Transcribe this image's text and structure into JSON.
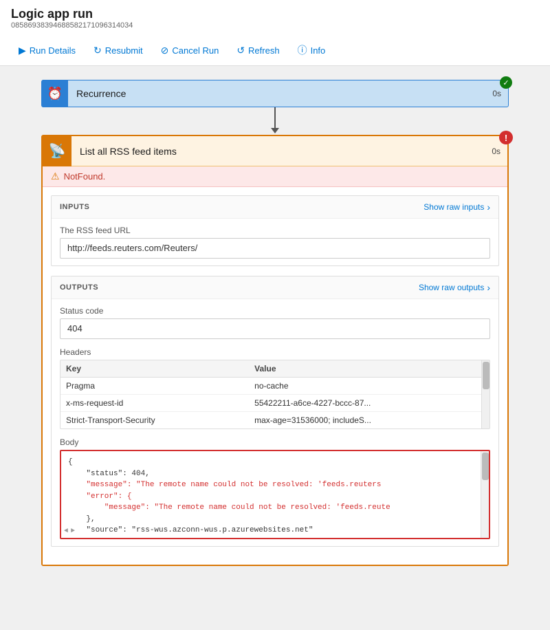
{
  "page": {
    "title": "Logic app run",
    "subtitle": "08586938394688582171096314034"
  },
  "toolbar": {
    "run_details_label": "Run Details",
    "resubmit_label": "Resubmit",
    "cancel_run_label": "Cancel Run",
    "refresh_label": "Refresh",
    "info_label": "Info"
  },
  "recurrence": {
    "label": "Recurrence",
    "time": "0s",
    "status": "success"
  },
  "rss_block": {
    "title": "List all RSS feed items",
    "time": "0s",
    "status": "error",
    "error_message": "NotFound.",
    "inputs": {
      "section_title": "INPUTS",
      "show_raw_label": "Show raw inputs",
      "rss_feed_url_label": "The RSS feed URL",
      "rss_feed_url_value": "http://feeds.reuters.com/Reuters/"
    },
    "outputs": {
      "section_title": "OUTPUTS",
      "show_raw_label": "Show raw outputs",
      "status_code_label": "Status code",
      "status_code_value": "404",
      "headers_label": "Headers",
      "headers": {
        "columns": [
          "Key",
          "Value"
        ],
        "rows": [
          {
            "key": "Pragma",
            "value": "no-cache"
          },
          {
            "key": "x-ms-request-id",
            "value": "55422211-a6ce-4227-bccc-87..."
          },
          {
            "key": "Strict-Transport-Security",
            "value": "max-age=31536000; includeS..."
          }
        ]
      },
      "body_label": "Body",
      "body_code": [
        {
          "text": "{",
          "color": "black"
        },
        {
          "text": "    \"status\": 404,",
          "color": "black"
        },
        {
          "text": "    \"message\": \"The remote name could not be resolved: 'feeds.reuters",
          "color": "red"
        },
        {
          "text": "    \"error\": {",
          "color": "red"
        },
        {
          "text": "        \"message\": \"The remote name could not be resolved: 'feeds.reute",
          "color": "red"
        },
        {
          "text": "    },",
          "color": "black"
        },
        {
          "text": "    \"source\": \"rss-wus.azconn-wus.p.azurewebsites.net\"",
          "color": "black"
        }
      ]
    }
  }
}
